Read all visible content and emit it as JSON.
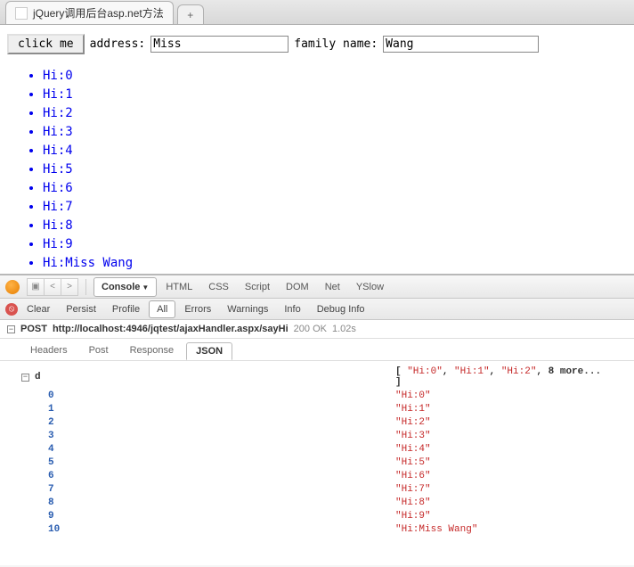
{
  "tab": {
    "title": "jQuery调用后台asp.net方法"
  },
  "form": {
    "button_label": "click me",
    "address_label": "address:",
    "address_value": "Miss",
    "family_label": "family name:",
    "family_value": "Wang"
  },
  "results": [
    "Hi:0",
    "Hi:1",
    "Hi:2",
    "Hi:3",
    "Hi:4",
    "Hi:5",
    "Hi:6",
    "Hi:7",
    "Hi:8",
    "Hi:9",
    "Hi:Miss Wang"
  ],
  "devtools": {
    "main_tabs": [
      "Console",
      "HTML",
      "CSS",
      "Script",
      "DOM",
      "Net",
      "YSlow"
    ],
    "active_main": "Console",
    "filter_tabs": [
      "Clear",
      "Persist",
      "Profile",
      "All",
      "Errors",
      "Warnings",
      "Info",
      "Debug Info"
    ],
    "active_filter": "All",
    "request": {
      "method": "POST",
      "url": "http://localhost:4946/jqtest/ajaxHandler.aspx/sayHi",
      "status": "200 OK",
      "time": "1.02s"
    },
    "sub_tabs": [
      "Headers",
      "Post",
      "Response",
      "JSON"
    ],
    "active_sub": "JSON",
    "json": {
      "root_key": "d",
      "summary_items": [
        "\"Hi:0\"",
        "\"Hi:1\"",
        "\"Hi:2\""
      ],
      "summary_more": "8 more...",
      "entries": [
        {
          "k": "0",
          "v": "\"Hi:0\""
        },
        {
          "k": "1",
          "v": "\"Hi:1\""
        },
        {
          "k": "2",
          "v": "\"Hi:2\""
        },
        {
          "k": "3",
          "v": "\"Hi:3\""
        },
        {
          "k": "4",
          "v": "\"Hi:4\""
        },
        {
          "k": "5",
          "v": "\"Hi:5\""
        },
        {
          "k": "6",
          "v": "\"Hi:6\""
        },
        {
          "k": "7",
          "v": "\"Hi:7\""
        },
        {
          "k": "8",
          "v": "\"Hi:8\""
        },
        {
          "k": "9",
          "v": "\"Hi:9\""
        },
        {
          "k": "10",
          "v": "\"Hi:Miss Wang\""
        }
      ]
    }
  }
}
